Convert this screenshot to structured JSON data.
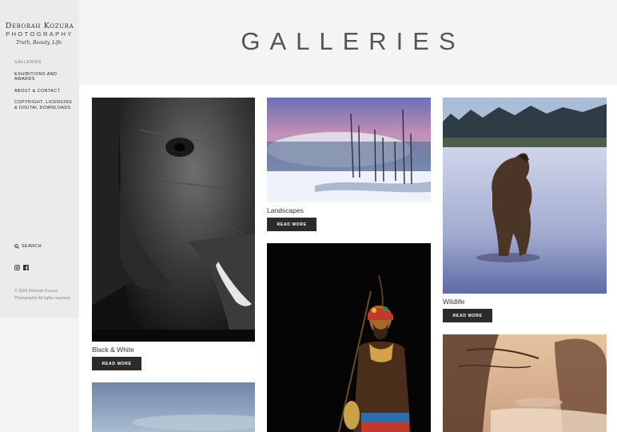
{
  "brand": {
    "name_line1": "Deborah Kozura",
    "name_line2": "PHOTOGRAPHY",
    "tagline": "Truth, Beauty, Life."
  },
  "nav": {
    "items": [
      {
        "label": "GALLERIES"
      },
      {
        "label": "EXHIBITIONS AND AWARDS"
      },
      {
        "label": "ABOUT & CONTACT"
      },
      {
        "label": "COPYRIGHT, LICENSING & DIGITAL DOWNLOADS"
      }
    ]
  },
  "search": {
    "label": "SEARCH",
    "icon": "search-icon"
  },
  "social": {
    "icons": [
      "instagram-icon",
      "facebook-icon"
    ]
  },
  "copyright": "© 2024 Deborah Kozura Photography All rights reserved",
  "page": {
    "title": "GALLERIES"
  },
  "galleries": [
    {
      "title": "Black & White",
      "button": "READ MORE"
    },
    {
      "title": "Landscapes",
      "button": "READ MORE"
    },
    {
      "title": "Wildlife",
      "button": "READ MORE"
    },
    {
      "title": "",
      "button": ""
    },
    {
      "title": "",
      "button": ""
    },
    {
      "title": "",
      "button": ""
    }
  ],
  "colors": {
    "sidebar_bg": "#ebebeb",
    "header_bg": "#f4f4f4",
    "button_bg": "#2b2b2b",
    "button_text": "#ffffff"
  }
}
